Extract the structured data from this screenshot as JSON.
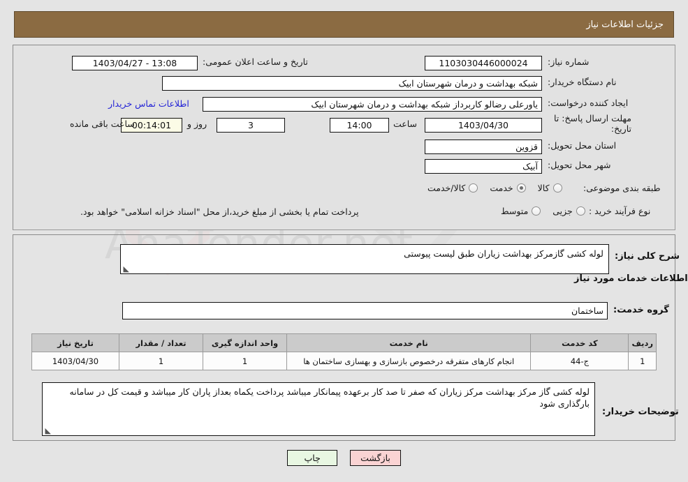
{
  "header": {
    "title": "جزئیات اطلاعات نیاز"
  },
  "form": {
    "announce_label": "تاریخ و ساعت اعلان عمومی:",
    "announce_value": "13:08 - 1403/04/27",
    "need_no_label": "شماره نیاز:",
    "need_no_value": "1103030446000024",
    "buyer_org_label": "نام دستگاه خریدار:",
    "buyer_org_value": "شبکه بهداشت و درمان شهرستان ابیک",
    "creator_label": "ایجاد کننده درخواست:",
    "creator_value": "یاورعلی رضالو کاربرداز شبکه بهداشت و درمان شهرستان ابیک",
    "contact_link": "اطلاعات تماس خریدار",
    "deadline_label": "مهلت ارسال پاسخ: تا تاریخ:",
    "deadline_date": "1403/04/30",
    "hour_label": "ساعت",
    "deadline_time": "14:00",
    "days_value": "3",
    "days_label": "روز و",
    "countdown_value": "00:14:01",
    "remaining_label": "ساعت باقی مانده",
    "province_label": "استان محل تحویل:",
    "province_value": "قزوین",
    "city_label": "شهر محل تحویل:",
    "city_value": "آبیک",
    "category_label": "طبقه بندی موضوعی:",
    "category_options": [
      "کالا",
      "خدمت",
      "کالا/خدمت"
    ],
    "category_selected": "خدمت",
    "process_label": "نوع فرآیند خرید :",
    "process_options": [
      "جزیی",
      "متوسط"
    ],
    "process_selected": "",
    "treasury_note": "پرداخت تمام یا بخشی از مبلغ خرید،از محل \"اسناد خزانه اسلامی\" خواهد بود."
  },
  "need_desc": {
    "label": "شرح کلی نیاز:",
    "value": "لوله کشی گازمرکز بهداشت زیاران طبق لیست پیوستی"
  },
  "services": {
    "section_title": "اطلاعات خدمات مورد نیاز",
    "group_label": "گروه خدمت:",
    "group_value": "ساختمان",
    "columns": [
      "ردیف",
      "کد خدمت",
      "نام خدمت",
      "واحد اندازه گیری",
      "تعداد / مقدار",
      "تاریخ نیاز"
    ],
    "rows": [
      {
        "no": "1",
        "code": "ج-44",
        "name": "انجام کارهای متفرقه درخصوص بازسازی و بهسازی ساختمان ها",
        "unit": "1",
        "qty": "1",
        "date": "1403/04/30"
      }
    ]
  },
  "buyer_notes": {
    "label": "توضیحات خریدار:",
    "value": "لوله کشی گاز مرکز بهداشت مرکز زیاران که صفر تا صد کار برعهده پیمانکار میباشد پرداخت یکماه بعداز پاران کار میباشد و قیمت کل در سامانه بارگذاری شود"
  },
  "buttons": {
    "back": "بازگشت",
    "print": "چاپ"
  },
  "watermark": {
    "text": "AnaTender.net"
  },
  "colors": {
    "header_bg": "#8b6b42",
    "page_bg": "#e4e4e4",
    "link": "#2323d6",
    "back_btn": "#fad3d3",
    "print_btn": "#e8f7e2"
  }
}
